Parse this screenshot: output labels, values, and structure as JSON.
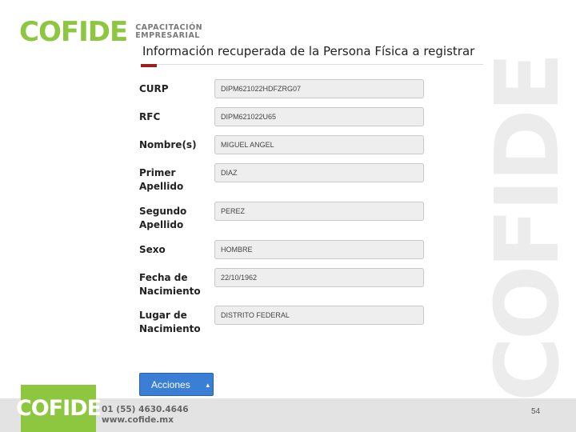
{
  "brand": {
    "logo_text": "COFIDE",
    "tagline_line1": "CAPACITACIÓN",
    "tagline_line2": "EMPRESARIAL",
    "watermark_text": "COFIDE",
    "colors": {
      "green": "#8dc63f",
      "accent_red": "#a11c1c",
      "button_blue": "#3a7fd5"
    }
  },
  "page": {
    "title": "Información recuperada de la Persona Física a registrar"
  },
  "form": {
    "fields": [
      {
        "label": "CURP",
        "value": "DIPM621022HDFZRG07"
      },
      {
        "label": "RFC",
        "value": "DIPM621022U65"
      },
      {
        "label": "Nombre(s)",
        "value": "MIGUEL ANGEL"
      },
      {
        "label": "Primer Apellido",
        "value": "DIAZ"
      },
      {
        "label": "Segundo Apellido",
        "value": "PEREZ"
      },
      {
        "label": "Sexo",
        "value": "HOMBRE"
      },
      {
        "label": "Fecha de Nacimiento",
        "value": "22/10/1962"
      },
      {
        "label": "Lugar de Nacimiento",
        "value": "DISTRITO FEDERAL"
      }
    ]
  },
  "actions": {
    "label": "Acciones",
    "caret": "▴"
  },
  "footer": {
    "logo_text": "COFIDE",
    "phone": "01 (55) 4630.4646",
    "website": "www.cofide.mx",
    "page_number": "54"
  }
}
